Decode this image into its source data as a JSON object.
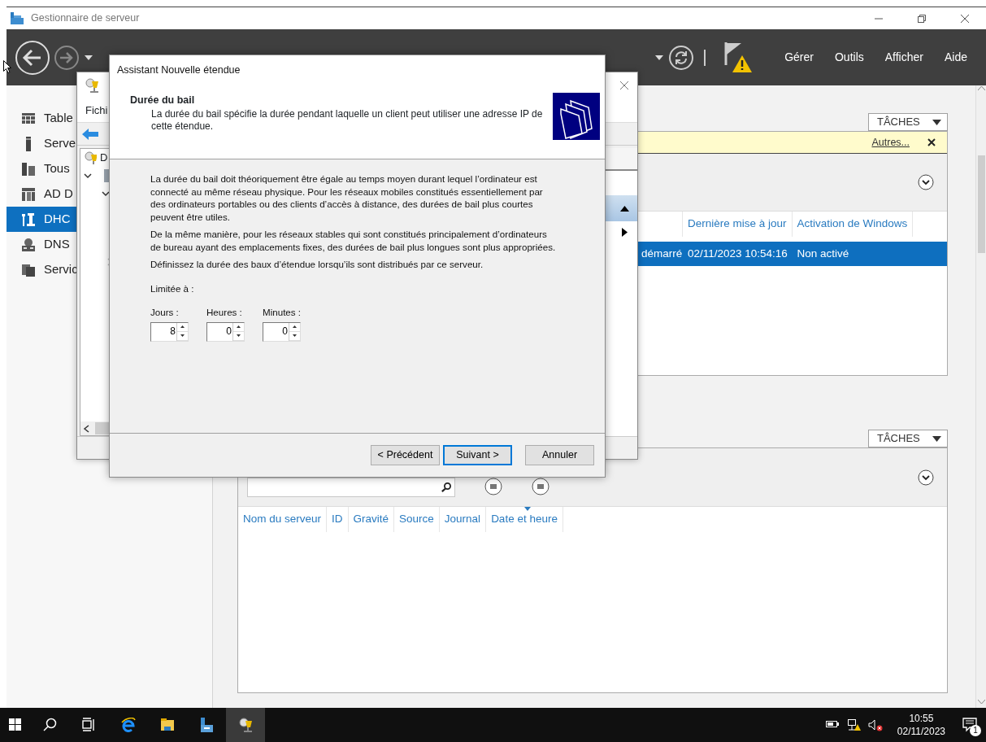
{
  "window": {
    "title": "Gestionnaire de serveur"
  },
  "header": {
    "menus": [
      "Gérer",
      "Outils",
      "Afficher",
      "Aide"
    ]
  },
  "sidebar": {
    "items": [
      {
        "kind": "dashboard",
        "label": "Table",
        "selected": false
      },
      {
        "kind": "server",
        "label": "Serve",
        "selected": false
      },
      {
        "kind": "servers",
        "label": "Tous",
        "selected": false
      },
      {
        "kind": "ad",
        "label": "AD D",
        "selected": false
      },
      {
        "kind": "dhcp",
        "label": "DHC",
        "selected": true
      },
      {
        "kind": "dns",
        "label": "DNS",
        "selected": false
      },
      {
        "kind": "services",
        "label": "Servic",
        "selected": false
      }
    ]
  },
  "sections": [
    {
      "tasks": "TÂCHES",
      "notice": {
        "link": "Autres..."
      },
      "columns": [
        {
          "label": "Dernière mise à jour",
          "sorted": false
        },
        {
          "label": "Activation de Windows",
          "sorted": false
        }
      ],
      "rows": [
        {
          "cut_cell": "démarré",
          "cells": [
            "02/11/2023 10:54:16",
            "Non activé"
          ],
          "selected": true
        }
      ]
    },
    {
      "tasks": "TÂCHES",
      "columns": [
        {
          "label": "Nom du serveur",
          "sorted": false
        },
        {
          "label": "ID",
          "sorted": false
        },
        {
          "label": "Gravité",
          "sorted": false
        },
        {
          "label": "Source",
          "sorted": false
        },
        {
          "label": "Journal",
          "sorted": false
        },
        {
          "label": "Date et heure",
          "sorted": true
        }
      ]
    }
  ],
  "console": {
    "menu": "Fichi",
    "tree": [
      {
        "label": "D",
        "expanded": true
      }
    ]
  },
  "dialog": {
    "title": "Assistant Nouvelle étendue",
    "heading": "Durée du bail",
    "subtitle": "La durée du bail spécifie la durée pendant laquelle un client peut utiliser une adresse IP de cette étendue.",
    "paragraphs": [
      "La durée du bail doit théoriquement être égale au temps moyen durant lequel l’ordinateur est connecté au même réseau physique. Pour les réseaux mobiles constitués essentiellement par des ordinateurs portables ou des clients d’accès à distance, des durées de bail plus courtes peuvent être utiles.",
      "De la même manière, pour les réseaux stables qui sont constitués principalement d’ordinateurs de bureau ayant des emplacements fixes, des durées de bail plus longues sont plus appropriées.",
      "Définissez la durée des baux d’étendue lorsqu’ils sont distribués par ce serveur."
    ],
    "limit_label": "Limitée à :",
    "spinners": [
      {
        "label": "Jours :",
        "value": "8"
      },
      {
        "label": "Heures :",
        "value": "0"
      },
      {
        "label": "Minutes :",
        "value": "0"
      }
    ],
    "buttons": [
      {
        "label": "< Précédent",
        "default": false
      },
      {
        "label": "Suivant >",
        "default": true
      },
      {
        "label": "Annuler",
        "default": false
      }
    ]
  },
  "taskbar": {
    "apps": [
      {
        "kind": "start",
        "active": false
      },
      {
        "kind": "search",
        "active": false
      },
      {
        "kind": "taskview",
        "active": false
      },
      {
        "kind": "browser",
        "active": false
      },
      {
        "kind": "folder",
        "active": false
      },
      {
        "kind": "servermanager",
        "active": false
      },
      {
        "kind": "dhcp",
        "active": true
      }
    ],
    "clock": {
      "time": "10:55",
      "date": "02/11/2023"
    },
    "notifications": "1"
  }
}
